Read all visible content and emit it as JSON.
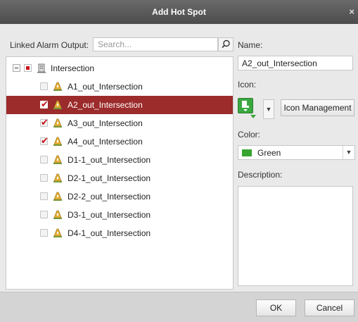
{
  "dialog": {
    "title": "Add Hot Spot",
    "close_glyph": "×"
  },
  "left": {
    "linked_label": "Linked Alarm Output:",
    "search_placeholder": "Search...",
    "root": {
      "label": "Intersection",
      "checkbox_state": "partial",
      "icon": "building-icon"
    },
    "items": [
      {
        "label": "A1_out_Intersection",
        "checked": false,
        "selected": false,
        "icon": "alarm-output-icon"
      },
      {
        "label": "A2_out_Intersection",
        "checked": true,
        "selected": true,
        "icon": "alarm-output-icon"
      },
      {
        "label": "A3_out_Intersection",
        "checked": true,
        "selected": false,
        "icon": "alarm-output-icon"
      },
      {
        "label": "A4_out_Intersection",
        "checked": true,
        "selected": false,
        "icon": "alarm-output-icon"
      },
      {
        "label": "D1-1_out_Intersection",
        "checked": false,
        "selected": false,
        "icon": "alarm-output-icon"
      },
      {
        "label": "D2-1_out_Intersection",
        "checked": false,
        "selected": false,
        "icon": "alarm-output-icon"
      },
      {
        "label": "D2-2_out_Intersection",
        "checked": false,
        "selected": false,
        "icon": "alarm-output-icon"
      },
      {
        "label": "D3-1_out_Intersection",
        "checked": false,
        "selected": false,
        "icon": "alarm-output-icon"
      },
      {
        "label": "D4-1_out_Intersection",
        "checked": false,
        "selected": false,
        "icon": "alarm-output-icon"
      }
    ]
  },
  "right": {
    "name_label": "Name:",
    "name_value": "A2_out_Intersection",
    "icon_label": "Icon:",
    "icon_management_label": "Icon Management",
    "color_label": "Color:",
    "color_value": "Green",
    "color_hex": "#37a52f",
    "description_label": "Description:",
    "description_value": ""
  },
  "footer": {
    "ok_label": "OK",
    "cancel_label": "Cancel"
  }
}
